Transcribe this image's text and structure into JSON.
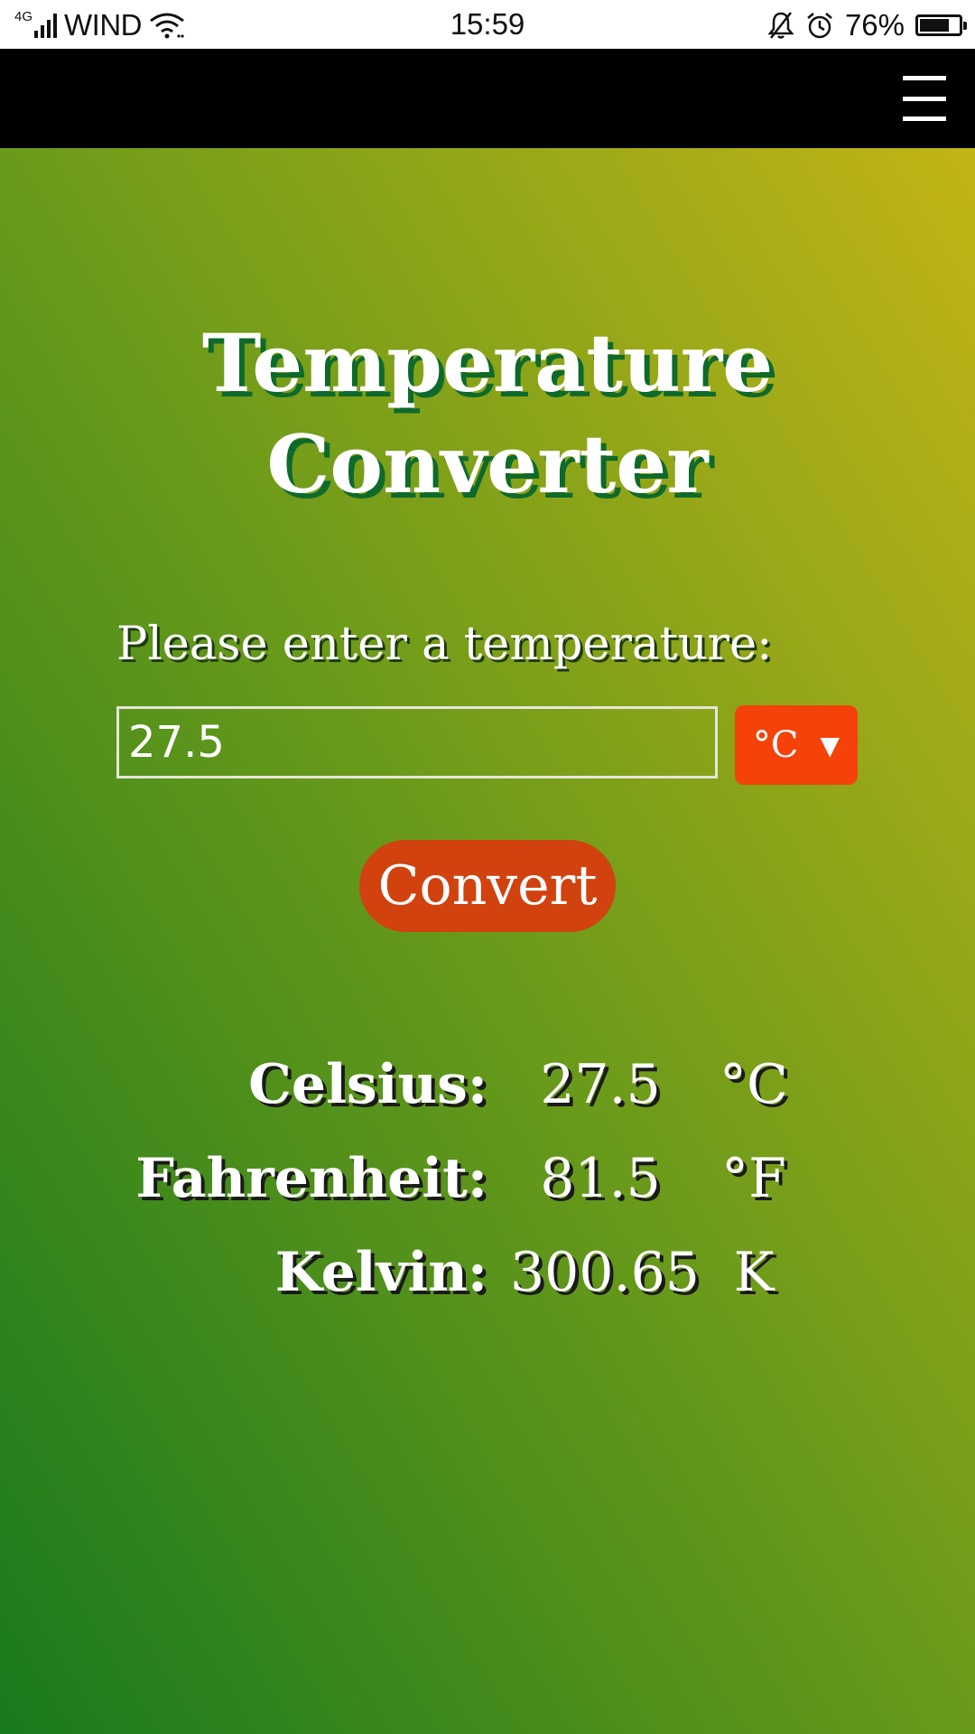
{
  "status_bar": {
    "network_type": "4G",
    "carrier": "WIND",
    "time": "15:59",
    "battery_percent": "76%",
    "battery_level": 0.76,
    "icons": [
      "signal-icon",
      "wifi-icon",
      "bell-muted-icon",
      "alarm-icon",
      "battery-icon"
    ]
  },
  "nav": {
    "menu_icon": "hamburger-menu-icon"
  },
  "main": {
    "title_line1": "Temperature",
    "title_line2": "Converter",
    "prompt": "Please enter a temperature:",
    "input_value": "27.5",
    "unit_selected": "°C",
    "convert_label": "Convert",
    "results": [
      {
        "label": "Celsius:",
        "value": "27.5",
        "unit": "°C"
      },
      {
        "label": "Fahrenheit:",
        "value": "81.5",
        "unit": "°F"
      },
      {
        "label": "Kelvin:",
        "value": "300.65",
        "unit": "K"
      }
    ]
  },
  "colors": {
    "gradient_start": "#187a1e",
    "gradient_end": "#c2b416",
    "accent_select": "#f44209",
    "accent_button": "#d1420f",
    "title_shadow": "#0e6a2a"
  }
}
